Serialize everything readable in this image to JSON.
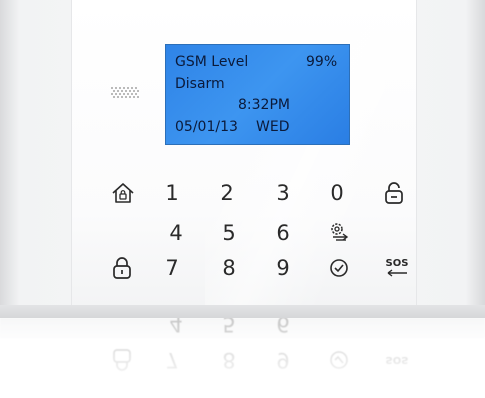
{
  "lcd": {
    "gsm_label": "GSM Level",
    "gsm_value": "99%",
    "status": "Disarm",
    "time": "8:32PM",
    "date": "05/01/13",
    "weekday": "WED"
  },
  "keypad": {
    "key_1": "1",
    "key_2": "2",
    "key_3": "3",
    "key_4": "4",
    "key_5": "5",
    "key_6": "6",
    "key_7": "7",
    "key_8": "8",
    "key_9": "9",
    "key_0": "0",
    "sos": "SOS"
  },
  "colors": {
    "lcd_background": "#3a91ee",
    "lcd_text": "#0b1a3a",
    "key_glyph": "#2a2a2a",
    "panel": "#f6f7f8"
  },
  "icons": {
    "home": "home-arm-icon",
    "unlock": "unlock-disarm-icon",
    "lock": "lock-arm-icon",
    "settings": "settings-icon",
    "confirm": "check-circle-icon",
    "speaker": "speaker-grille-icon",
    "sos_arrow": "arrow-left-icon"
  }
}
